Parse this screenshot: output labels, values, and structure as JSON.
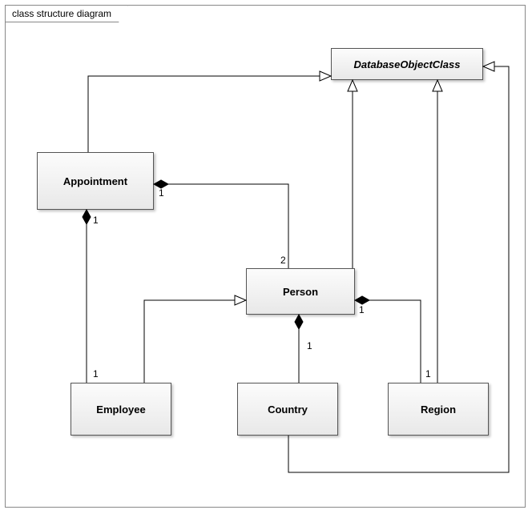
{
  "frame": {
    "title": "class structure diagram"
  },
  "classes": {
    "databaseObjectClass": "DatabaseObjectClass",
    "appointment": "Appointment",
    "person": "Person",
    "employee": "Employee",
    "country": "Country",
    "region": "Region"
  },
  "mult": {
    "appt_emp_top": "1",
    "appt_emp_bottom": "1",
    "appt_person_appt": "1",
    "appt_person_person": "2",
    "person_country": "1",
    "person_region_person": "1",
    "person_region_region": "1"
  },
  "chart_data": {
    "type": "uml-class-diagram",
    "title": "class structure diagram",
    "classes": [
      {
        "name": "DatabaseObjectClass",
        "abstract": true
      },
      {
        "name": "Appointment",
        "abstract": false
      },
      {
        "name": "Person",
        "abstract": false
      },
      {
        "name": "Employee",
        "abstract": false
      },
      {
        "name": "Country",
        "abstract": false
      },
      {
        "name": "Region",
        "abstract": false
      }
    ],
    "relations": [
      {
        "type": "generalization",
        "from": "Appointment",
        "to": "DatabaseObjectClass"
      },
      {
        "type": "generalization",
        "from": "Person",
        "to": "DatabaseObjectClass"
      },
      {
        "type": "generalization",
        "from": "Country",
        "to": "DatabaseObjectClass"
      },
      {
        "type": "generalization",
        "from": "Region",
        "to": "DatabaseObjectClass"
      },
      {
        "type": "generalization",
        "from": "Employee",
        "to": "Person"
      },
      {
        "type": "composition",
        "whole": "Appointment",
        "part": "Employee",
        "wholeMult": "1",
        "partMult": "1"
      },
      {
        "type": "composition",
        "whole": "Appointment",
        "part": "Person",
        "wholeMult": "1",
        "partMult": "2"
      },
      {
        "type": "composition",
        "whole": "Person",
        "part": "Country",
        "wholeMult": null,
        "partMult": "1"
      },
      {
        "type": "composition",
        "whole": "Person",
        "part": "Region",
        "wholeMult": "1",
        "partMult": "1"
      }
    ]
  }
}
